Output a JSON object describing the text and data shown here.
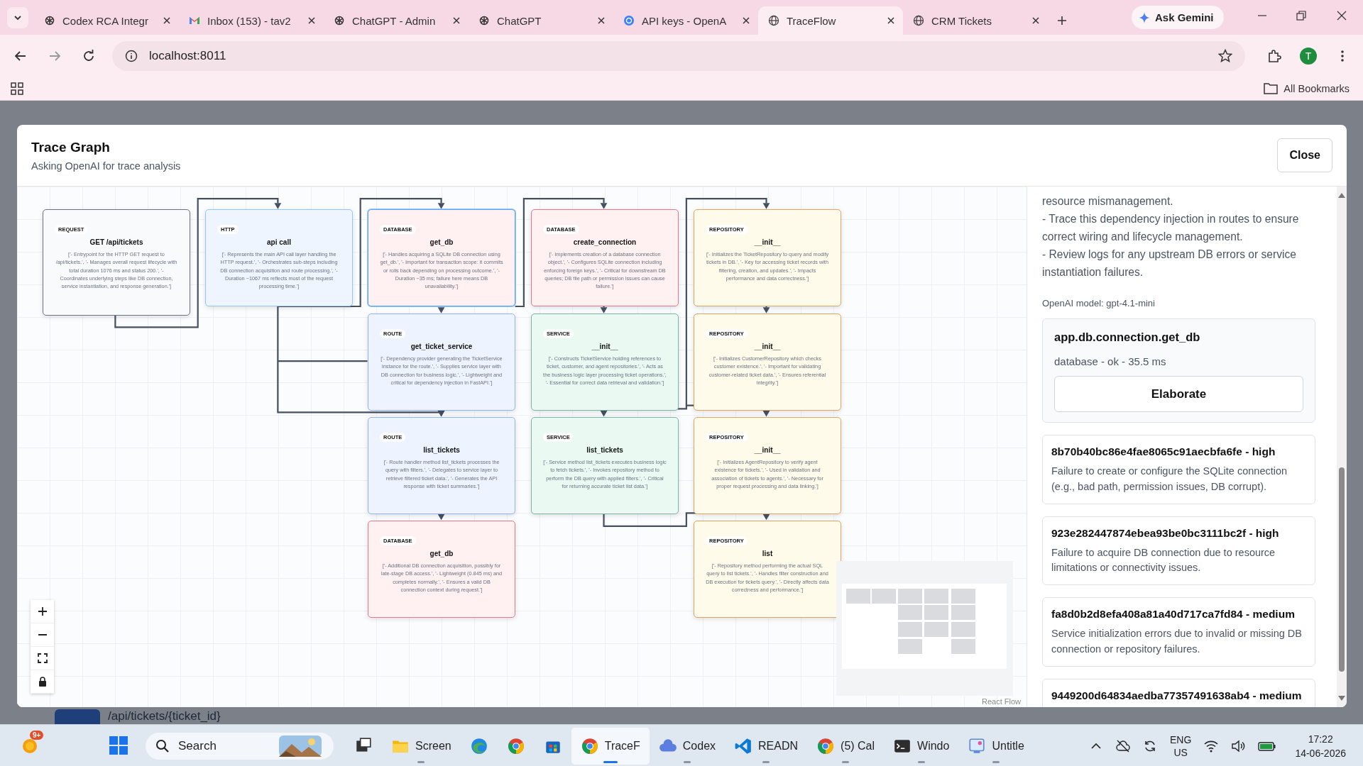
{
  "browser": {
    "tabs": [
      {
        "kind": "openai",
        "title": "Codex RCA Integr",
        "selected": false
      },
      {
        "kind": "mail",
        "title": "Inbox (153) - tav2",
        "selected": false
      },
      {
        "kind": "openai",
        "title": "ChatGPT - Admin",
        "selected": false
      },
      {
        "kind": "openai",
        "title": "ChatGPT",
        "selected": false
      },
      {
        "kind": "openai-blue",
        "title": "API keys - OpenA",
        "selected": false
      },
      {
        "kind": "globe",
        "title": "TraceFlow",
        "selected": true
      },
      {
        "kind": "globe",
        "title": "CRM Tickets",
        "selected": false
      }
    ],
    "gemini_button": "Ask Gemini",
    "address": "localhost:8011",
    "profile_initial": "T",
    "bookmarks_label": "All Bookmarks"
  },
  "page_behind": {
    "path": "/api/tickets/{ticket_id}"
  },
  "modal": {
    "title": "Trace Graph",
    "subtitle": "Asking OpenAI for trace analysis",
    "close_button": "Close",
    "graph": {
      "attribution": "React Flow",
      "nodes": [
        {
          "kind": "request",
          "badge": "REQUEST",
          "title": "GET /api/tickets",
          "selected": false,
          "description": "['- Entrypoint for the HTTP GET request to /api/tickets.', '- Manages overall request lifecycle with total duration 1076 ms and status 200.', '- Coordinates underlying steps like DB connection, service instantiation, and response generation.']"
        },
        {
          "kind": "http",
          "badge": "HTTP",
          "title": "api call",
          "selected": false,
          "description": "['- Represents the main API call layer handling the HTTP request.', '- Orchestrates sub-steps including DB connection acquisition and route processing.', '- Duration ~1067 ms reflects most of the request processing time.']"
        },
        {
          "kind": "database",
          "badge": "DATABASE",
          "title": "get_db",
          "selected": true,
          "description": "['- Handles acquiring a SQLite DB connection using get_db.', '- Important for transaction scope: it commits or rolls back depending on processing outcome.', '- Duration ~35 ms; failure here means DB unavailability.']"
        },
        {
          "kind": "database",
          "badge": "DATABASE",
          "title": "create_connection",
          "selected": false,
          "description": "['- Implements creation of a database connection object.', '- Configures SQLite connection including enforcing foreign keys.', '- Critical for downstream DB queries; DB file path or permission issues can cause failure.']"
        },
        {
          "kind": "repository",
          "badge": "REPOSITORY",
          "title": "__init__",
          "selected": false,
          "description": "['- Initializes the TicketRepository to query and modify tickets in DB.', '- Key for accessing ticket records with filtering, creation, and updates.', '- Impacts performance and data correctness.']"
        },
        {
          "kind": "route",
          "badge": "ROUTE",
          "title": "get_ticket_service",
          "selected": false,
          "description": "['- Dependency provider generating the TicketService instance for the route.', '- Supplies service layer with DB connection for business logic.', '- Lightweight and critical for dependency injection in FastAPI.']"
        },
        {
          "kind": "service",
          "badge": "SERVICE",
          "title": "__init__",
          "selected": false,
          "description": "['- Constructs TicketService holding references to ticket, customer, and agent repositories.', '- Acts as the business logic layer processing ticket operations.', '- Essential for correct data retrieval and validation.']"
        },
        {
          "kind": "repository",
          "badge": "REPOSITORY",
          "title": "__init__",
          "selected": false,
          "description": "['- Initializes CustomerRepository which checks customer existence.', '- Important for validating customer-related ticket data.', '- Ensures referential integrity.']"
        },
        {
          "kind": "route",
          "badge": "ROUTE",
          "title": "list_tickets",
          "selected": false,
          "description": "['- Route handler method list_tickets processes the query with filters.', '- Delegates to service layer to retrieve filtered ticket data.', '- Generates the API response with ticket summaries.']"
        },
        {
          "kind": "service",
          "badge": "SERVICE",
          "title": "list_tickets",
          "selected": false,
          "description": "['- Service method list_tickets executes business logic to fetch tickets.', '- Invokes repository method to perform the DB query with applied filters.', '- Critical for returning accurate ticket list data.']"
        },
        {
          "kind": "repository",
          "badge": "REPOSITORY",
          "title": "__init__",
          "selected": false,
          "description": "['- Initializes AgentRepository to verify agent existence for tickets.', '- Used in validation and association of tickets to agents.', '- Necessary for proper request processing and data linking.']"
        },
        {
          "kind": "database",
          "badge": "DATABASE",
          "title": "get_db",
          "selected": false,
          "description": "['- Additional DB connection acquisition, possibly for late-stage DB access.', '- Lightweight (0.845 ms) and completes normally.', '- Ensures a valid DB connection context during request.']"
        },
        {
          "kind": "repository",
          "badge": "REPOSITORY",
          "title": "list",
          "selected": false,
          "description": "['- Repository method performing the actual SQL query to list tickets.', '- Handles filter construction and DB execution for tickets query.', '- Directly affects data correctness and performance.']"
        }
      ]
    },
    "analysis": {
      "lines": [
        "resource mismanagement.",
        "- Trace this dependency injection in routes to ensure correct wiring and lifecycle management.",
        "- Review logs for any upstream DB errors or service instantiation failures."
      ],
      "model": "OpenAI model: gpt-4.1-mini",
      "selected_span": {
        "name": "app.db.connection.get_db",
        "meta": "database - ok - 35.5 ms",
        "button": "Elaborate"
      },
      "findings": [
        {
          "title": "8b70b40bc86e4fae8065c91aecbfa6fe - high",
          "description": "Failure to create or configure the SQLite connection (e.g., bad path, permission issues, DB corrupt)."
        },
        {
          "title": "923e282447874ebea93be0bc3111bc2f - high",
          "description": "Failure to acquire DB connection due to resource limitations or connectivity issues."
        },
        {
          "title": "fa8d0b2d8efa408a81a40d717ca7fd84 - medium",
          "description": "Service initialization errors due to invalid or missing DB connection or repository failures."
        },
        {
          "title": "9449200d64834aedba77357491638ab4 - medium"
        }
      ]
    }
  },
  "taskbar": {
    "weather_badge": "9+",
    "search_placeholder": "Search",
    "apps": [
      {
        "kind": "taskview",
        "selected": false
      },
      {
        "kind": "explorer",
        "label": "Screen",
        "selected": false
      },
      {
        "kind": "edge",
        "selected": false
      },
      {
        "kind": "chrome",
        "selected": false
      },
      {
        "kind": "store",
        "selected": false
      },
      {
        "kind": "chrome",
        "label": "TraceF",
        "selected": true
      },
      {
        "kind": "codex",
        "label": "Codex",
        "selected": false
      },
      {
        "kind": "vscode",
        "label": "READN",
        "selected": false
      },
      {
        "kind": "chrome",
        "label": "(5) Cal",
        "selected": false
      },
      {
        "kind": "terminal",
        "label": "Windo",
        "selected": false
      },
      {
        "kind": "paint",
        "label": "Untitle",
        "selected": false
      }
    ],
    "language": "ENG",
    "region": "US",
    "time": "17:22",
    "date": "14-06-2026"
  }
}
